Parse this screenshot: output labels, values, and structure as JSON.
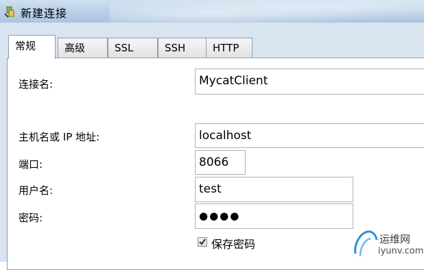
{
  "window": {
    "title": "新建连接"
  },
  "tabs": [
    {
      "label": "常规",
      "active": true
    },
    {
      "label": "高级",
      "active": false
    },
    {
      "label": "SSL",
      "active": false
    },
    {
      "label": "SSH",
      "active": false
    },
    {
      "label": "HTTP",
      "active": false
    }
  ],
  "form": {
    "connection_name": {
      "label": "连接名:",
      "value": "MycatClient"
    },
    "host": {
      "label": "主机名或 IP 地址:",
      "value": "localhost"
    },
    "port": {
      "label": "端口:",
      "value": "8066"
    },
    "username": {
      "label": "用户名:",
      "value": "test"
    },
    "password": {
      "label": "密码:",
      "value": "●●●●"
    },
    "save_password": {
      "label": "保存密码",
      "checked": true
    }
  },
  "watermark": {
    "name": "运维网",
    "url": "iyunv.com"
  },
  "colors": {
    "titlebar": "#bcd2e8",
    "frame": "#d9e4f1",
    "border": "#8e9eb1"
  }
}
